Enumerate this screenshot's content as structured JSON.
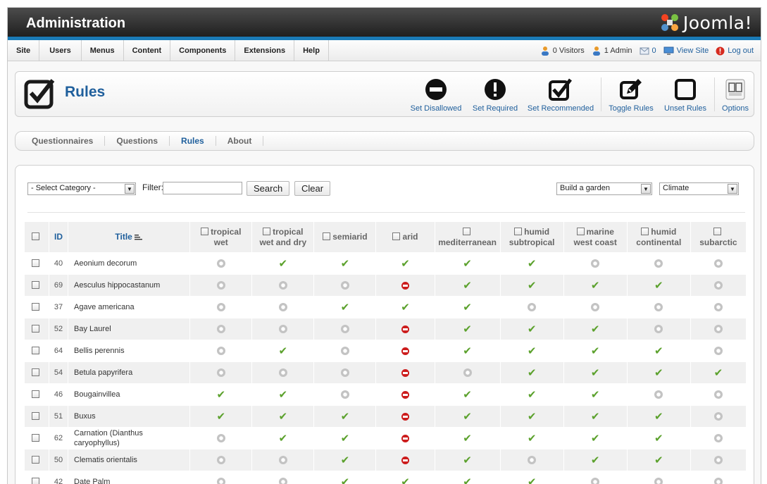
{
  "header": {
    "title": "Administration",
    "brand": "Joomla!"
  },
  "menubar": {
    "items": [
      "Site",
      "Users",
      "Menus",
      "Content",
      "Components",
      "Extensions",
      "Help"
    ],
    "status": {
      "visitors": "0 Visitors",
      "admins": "1 Admin",
      "messages": "0",
      "view_site": "View Site",
      "logout": "Log out"
    }
  },
  "toolbar": {
    "title": "Rules",
    "buttons": [
      {
        "label": "Set Disallowed",
        "icon": "disallowed-icon"
      },
      {
        "label": "Set Required",
        "icon": "required-icon"
      },
      {
        "label": "Set Recommended",
        "icon": "recommended-icon"
      },
      {
        "label": "Toggle Rules",
        "icon": "toggle-icon"
      },
      {
        "label": "Unset Rules",
        "icon": "unset-icon"
      },
      {
        "label": "Options",
        "icon": "options-icon"
      }
    ]
  },
  "submenu": {
    "items": [
      "Questionnaires",
      "Questions",
      "Rules",
      "About"
    ],
    "active": "Rules"
  },
  "filters": {
    "category": "- Select Category -",
    "filter_label": "Filter:",
    "filter_value": "",
    "search": "Search",
    "clear": "Clear",
    "questionnaire": "Build a garden",
    "question": "Climate"
  },
  "table": {
    "id_header": "ID",
    "title_header": "Title",
    "columns": [
      [
        "tropical",
        "wet"
      ],
      [
        "tropical",
        "wet and dry"
      ],
      [
        "semiarid"
      ],
      [
        "arid"
      ],
      [
        "",
        "mediterranean"
      ],
      [
        "humid",
        "subtropical"
      ],
      [
        "marine",
        "west coast"
      ],
      [
        "humid",
        "continental"
      ],
      [
        "",
        "subarctic"
      ]
    ],
    "rows": [
      {
        "id": "40",
        "title": "Aeonium decorum",
        "cells": [
          "n",
          "o",
          "o",
          "o",
          "o",
          "o",
          "n",
          "n",
          "n"
        ]
      },
      {
        "id": "69",
        "title": "Aesculus hippocastanum",
        "cells": [
          "n",
          "n",
          "n",
          "x",
          "o",
          "o",
          "o",
          "o",
          "n"
        ]
      },
      {
        "id": "37",
        "title": "Agave americana",
        "cells": [
          "n",
          "n",
          "o",
          "o",
          "o",
          "n",
          "n",
          "n",
          "n"
        ]
      },
      {
        "id": "52",
        "title": "Bay Laurel",
        "cells": [
          "n",
          "n",
          "n",
          "x",
          "o",
          "o",
          "o",
          "n",
          "n"
        ]
      },
      {
        "id": "64",
        "title": "Bellis perennis",
        "cells": [
          "n",
          "o",
          "n",
          "x",
          "o",
          "o",
          "o",
          "o",
          "n"
        ]
      },
      {
        "id": "54",
        "title": "Betula papyrifera",
        "cells": [
          "n",
          "n",
          "n",
          "x",
          "n",
          "o",
          "o",
          "o",
          "o"
        ]
      },
      {
        "id": "46",
        "title": "Bougainvillea",
        "cells": [
          "o",
          "o",
          "n",
          "x",
          "o",
          "o",
          "o",
          "n",
          "n"
        ]
      },
      {
        "id": "51",
        "title": "Buxus",
        "cells": [
          "o",
          "o",
          "o",
          "x",
          "o",
          "o",
          "o",
          "o",
          "n"
        ]
      },
      {
        "id": "62",
        "title": "Carnation (Dianthus caryophyllus)",
        "cells": [
          "n",
          "o",
          "o",
          "x",
          "o",
          "o",
          "o",
          "o",
          "n"
        ]
      },
      {
        "id": "50",
        "title": "Clematis orientalis",
        "cells": [
          "n",
          "n",
          "o",
          "x",
          "o",
          "n",
          "o",
          "o",
          "n"
        ]
      },
      {
        "id": "42",
        "title": "Date Palm",
        "cells": [
          "n",
          "n",
          "o",
          "o",
          "o",
          "o",
          "n",
          "n",
          "n"
        ]
      }
    ]
  },
  "colors": {
    "accent": "#1f5f9c",
    "allowed": "#5ba12c",
    "disallowed": "#cc1c1c",
    "header_bar": "#1a7bb7"
  }
}
